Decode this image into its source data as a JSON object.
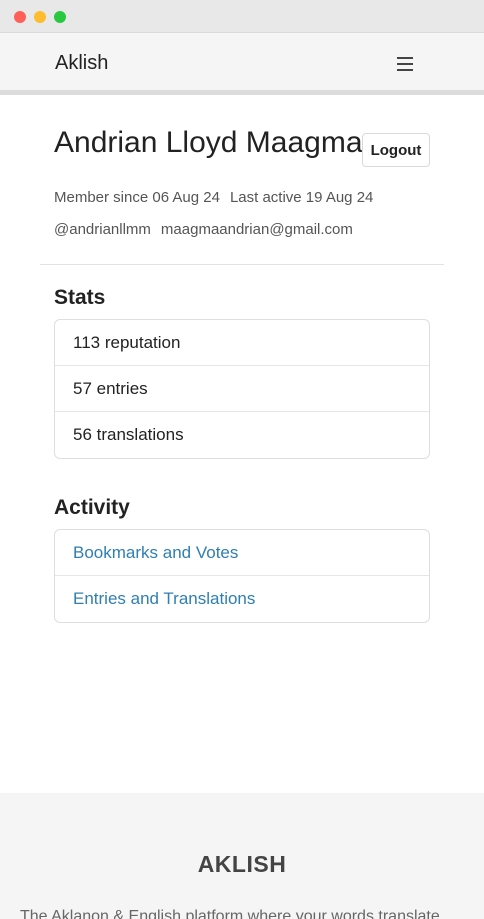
{
  "navbar": {
    "brand": "Aklish",
    "menu_icon": "hamburger-menu-icon"
  },
  "profile": {
    "name": "Andrian Lloyd Maagma",
    "logout_label": "Logout",
    "member_since": "Member since 06 Aug 24",
    "last_active": "Last active 19 Aug 24",
    "username": "@andrianllmm",
    "email": "maagmaandrian@gmail.com"
  },
  "stats": {
    "title": "Stats",
    "items": [
      {
        "label": "113 reputation"
      },
      {
        "label": "57 entries"
      },
      {
        "label": "56 translations"
      }
    ]
  },
  "activity": {
    "title": "Activity",
    "items": [
      {
        "label": "Bookmarks and Votes"
      },
      {
        "label": "Entries and Translations"
      }
    ]
  },
  "footer": {
    "title": "AKLISH",
    "tagline": "The Aklanon & English platform where your words translate"
  },
  "colors": {
    "link": "#2f7fb0",
    "navbar_bg": "#f5f5f5",
    "footer_bg": "#f5f5f5"
  }
}
